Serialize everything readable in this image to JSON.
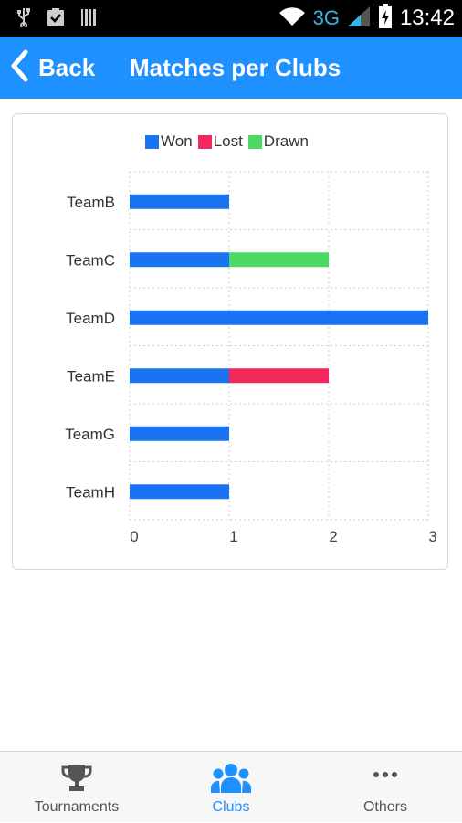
{
  "status_bar": {
    "network": "3G",
    "time": "13:42"
  },
  "header": {
    "back_label": "Back",
    "title": "Matches per Clubs"
  },
  "colors": {
    "accent": "#1e90ff",
    "won": "#1a73f0",
    "lost": "#f2285a",
    "drawn": "#4cd964"
  },
  "chart_data": {
    "type": "bar",
    "orientation": "horizontal",
    "stacked": true,
    "categories": [
      "TeamB",
      "TeamC",
      "TeamD",
      "TeamE",
      "TeamG",
      "TeamH"
    ],
    "series": [
      {
        "name": "Won",
        "color": "#1a73f0",
        "values": [
          1,
          1,
          3,
          1,
          1,
          1
        ]
      },
      {
        "name": "Lost",
        "color": "#f2285a",
        "values": [
          0,
          0,
          0,
          1,
          0,
          0
        ]
      },
      {
        "name": "Drawn",
        "color": "#4cd964",
        "values": [
          0,
          1,
          0,
          0,
          0,
          0
        ]
      }
    ],
    "x_ticks": [
      "0",
      "1",
      "2",
      "3"
    ],
    "xlim": [
      0,
      3
    ],
    "grid": true,
    "legend_position": "top-center"
  },
  "bottom_nav": {
    "items": [
      {
        "label": "Tournaments",
        "icon": "trophy-icon",
        "active": false
      },
      {
        "label": "Clubs",
        "icon": "group-icon",
        "active": true
      },
      {
        "label": "Others",
        "icon": "more-dots-icon",
        "active": false
      }
    ]
  }
}
